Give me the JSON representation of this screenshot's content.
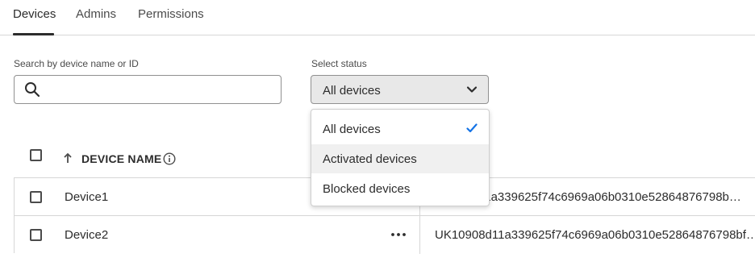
{
  "tabs": [
    {
      "label": "Devices",
      "active": true
    },
    {
      "label": "Admins",
      "active": false
    },
    {
      "label": "Permissions",
      "active": false
    }
  ],
  "search": {
    "label": "Search by device name or ID",
    "value": "",
    "icon": "search-icon"
  },
  "status_select": {
    "label": "Select status",
    "value": "All devices",
    "icon": "chevron-down-icon",
    "options": [
      {
        "label": "All devices",
        "selected": true
      },
      {
        "label": "Activated devices",
        "selected": false,
        "hovered": true
      },
      {
        "label": "Blocked devices",
        "selected": false
      }
    ]
  },
  "table": {
    "columns": [
      {
        "label": "DEVICE NAME",
        "sort": "ascending",
        "info_icon": true
      },
      {
        "label": "",
        "note": "second column header hidden by dropdown"
      }
    ],
    "rows": [
      {
        "name": "Device1",
        "device_id": "…11a339625f74c6969a06b0310e52864876798b…"
      },
      {
        "name": "Device2",
        "device_id": "UK10908d11a339625f74c6969a06b0310e52864876798bf…"
      }
    ],
    "row_actions_icon": "more-horizontal-icon"
  },
  "colors": {
    "accent_check": "#1473e6",
    "border": "#909090",
    "divider": "#d6d6d6",
    "select_bg": "#e8e8e8",
    "hover_bg": "#f0f0f0"
  }
}
